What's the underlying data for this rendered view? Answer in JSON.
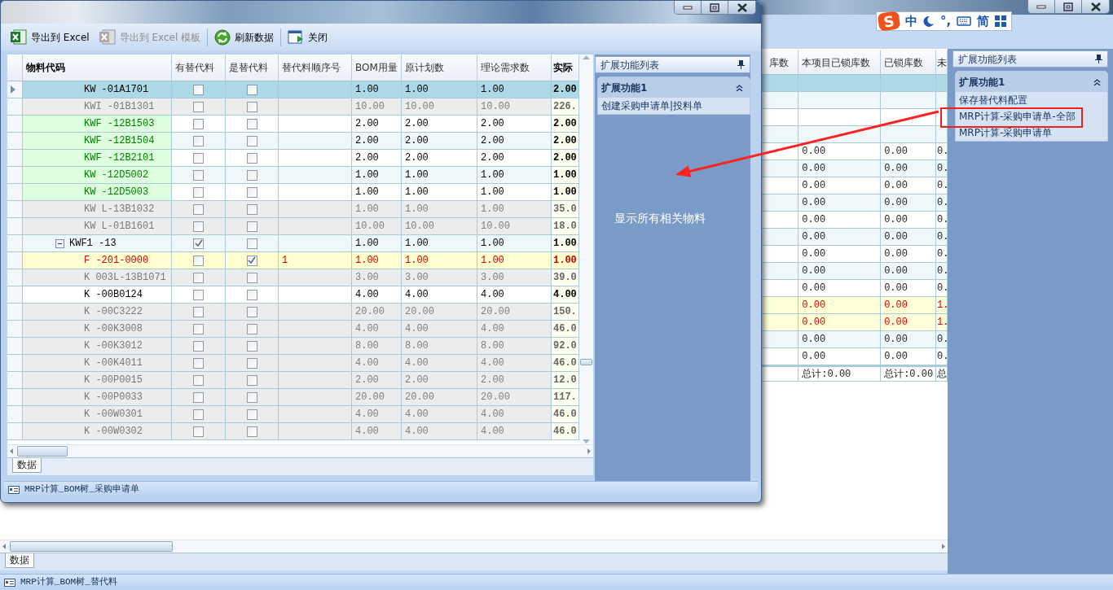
{
  "background": {
    "ime": {
      "logo": "S",
      "items": [
        "中",
        "°,",
        "简"
      ]
    },
    "grid": {
      "columns": [
        "库数",
        "本项目已锁库数",
        "已锁库数",
        "未"
      ],
      "rows": [
        {
          "selected": true,
          "kind": "normal"
        },
        {
          "selected": false,
          "kind": "normal"
        },
        {
          "selected": false,
          "kind": "normal"
        },
        {
          "selected": false,
          "kind": "normal"
        },
        {
          "selected": false,
          "kind": "normal",
          "cells": [
            "0.00",
            "0.00",
            "0."
          ]
        },
        {
          "selected": false,
          "kind": "normal",
          "cells": [
            "0.00",
            "0.00",
            "0."
          ]
        },
        {
          "selected": false,
          "kind": "normal",
          "cells": [
            "0.00",
            "0.00",
            "0."
          ]
        },
        {
          "selected": false,
          "kind": "normal",
          "cells": [
            "0.00",
            "0.00",
            "0."
          ]
        },
        {
          "selected": false,
          "kind": "normal",
          "cells": [
            "0.00",
            "0.00",
            "0."
          ]
        },
        {
          "selected": false,
          "kind": "normal",
          "cells": [
            "0.00",
            "0.00",
            "0."
          ]
        },
        {
          "selected": false,
          "kind": "normal",
          "cells": [
            "0.00",
            "0.00",
            "0."
          ]
        },
        {
          "selected": false,
          "kind": "normal",
          "cells": [
            "0.00",
            "0.00",
            "0."
          ]
        },
        {
          "selected": false,
          "kind": "normal",
          "cells": [
            "0.00",
            "0.00",
            "0."
          ]
        },
        {
          "selected": false,
          "kind": "warn",
          "cells": [
            "0.00",
            "0.00",
            "1."
          ]
        },
        {
          "selected": false,
          "kind": "warn",
          "cells": [
            "0.00",
            "0.00",
            "1."
          ]
        },
        {
          "selected": false,
          "kind": "normal",
          "cells": [
            "0.00",
            "0.00",
            "0."
          ]
        },
        {
          "selected": false,
          "kind": "normal",
          "cells": [
            "0.00",
            "0.00",
            "0."
          ]
        }
      ],
      "totals": [
        "总计:0.00",
        "总计:0.00",
        "总"
      ]
    },
    "tabs": [
      {
        "label": "数据",
        "selected": true
      }
    ],
    "panel": {
      "title": "扩展功能列表",
      "groups": [
        {
          "title": "扩展功能1",
          "expanded": true,
          "items": [
            "保存替代料配置",
            "MRP计算-采购申请单-全部",
            "MRP计算-采购申请单"
          ]
        }
      ]
    },
    "status": "MRP计算_BOM树_替代料"
  },
  "dialog": {
    "toolbar": [
      {
        "label": "导出到 Excel",
        "disabled": false
      },
      {
        "label": "导出到 Excel 模板",
        "disabled": true
      },
      {
        "label": "刷新数据",
        "disabled": false
      },
      {
        "label": "关闭",
        "disabled": false
      }
    ],
    "grid": {
      "columns": [
        "物料代码",
        "有替代料",
        "是替代料",
        "替代料顺序号",
        "BOM用量",
        "原计划数",
        "理论需求数",
        "实际"
      ],
      "rows": [
        {
          "kind": "normal",
          "selected": true,
          "code": "KW -01A1701",
          "has_sub": false,
          "is_sub": false,
          "bom": "1.00",
          "plan": "1.00",
          "need": "1.00",
          "actual": "2.00"
        },
        {
          "kind": "grey",
          "selected": false,
          "code": "KWI -01B1301",
          "has_sub": false,
          "is_sub": false,
          "bom": "10.00",
          "plan": "10.00",
          "need": "10.00",
          "actual": "226."
        },
        {
          "kind": "green",
          "selected": false,
          "code": "KWF -12B1503",
          "has_sub": false,
          "is_sub": false,
          "bom": "2.00",
          "plan": "2.00",
          "need": "2.00",
          "actual": "2.00"
        },
        {
          "kind": "green",
          "selected": false,
          "code": "KWF -12B1504",
          "has_sub": false,
          "is_sub": false,
          "bom": "2.00",
          "plan": "2.00",
          "need": "2.00",
          "actual": "2.00"
        },
        {
          "kind": "green",
          "selected": false,
          "code": "KWF -12B2101",
          "has_sub": false,
          "is_sub": false,
          "bom": "2.00",
          "plan": "2.00",
          "need": "2.00",
          "actual": "2.00"
        },
        {
          "kind": "green",
          "selected": false,
          "code": "KW -12D5002",
          "has_sub": false,
          "is_sub": false,
          "bom": "1.00",
          "plan": "1.00",
          "need": "1.00",
          "actual": "1.00"
        },
        {
          "kind": "green",
          "selected": false,
          "code": "KW -12D5003",
          "has_sub": false,
          "is_sub": false,
          "bom": "1.00",
          "plan": "1.00",
          "need": "1.00",
          "actual": "1.00"
        },
        {
          "kind": "grey",
          "selected": false,
          "code": "KW L-13B1032",
          "has_sub": false,
          "is_sub": false,
          "bom": "1.00",
          "plan": "1.00",
          "need": "1.00",
          "actual": "35.0"
        },
        {
          "kind": "grey",
          "selected": false,
          "code": "KW L-01B1601",
          "has_sub": false,
          "is_sub": false,
          "bom": "10.00",
          "plan": "10.00",
          "need": "10.00",
          "actual": "18.0"
        },
        {
          "kind": "normal",
          "selected": false,
          "code": "KWF1 -13",
          "has_sub": true,
          "is_sub": false,
          "bom": "1.00",
          "plan": "1.00",
          "need": "1.00",
          "actual": "1.00",
          "expanded": true,
          "children": [
            {
              "kind": "red",
              "selected": false,
              "code": "F -201-0000",
              "has_sub": false,
              "is_sub": true,
              "seq": "1",
              "bom": "1.00",
              "plan": "1.00",
              "need": "1.00",
              "actual": "1.00"
            },
            {
              "kind": "grey",
              "selected": false,
              "code": "K 003L-13B1071",
              "has_sub": false,
              "is_sub": false,
              "bom": "3.00",
              "plan": "3.00",
              "need": "3.00",
              "actual": "39.0"
            },
            {
              "kind": "normal",
              "selected": false,
              "code": "K -00B0124",
              "has_sub": false,
              "is_sub": false,
              "bom": "4.00",
              "plan": "4.00",
              "need": "4.00",
              "actual": "4.00"
            },
            {
              "kind": "grey",
              "selected": false,
              "code": "K -00C3222",
              "has_sub": false,
              "is_sub": false,
              "bom": "20.00",
              "plan": "20.00",
              "need": "20.00",
              "actual": "150."
            },
            {
              "kind": "grey",
              "selected": false,
              "code": "K -00K3008",
              "has_sub": false,
              "is_sub": false,
              "bom": "4.00",
              "plan": "4.00",
              "need": "4.00",
              "actual": "46.0"
            },
            {
              "kind": "grey",
              "selected": false,
              "code": "K -00K3012",
              "has_sub": false,
              "is_sub": false,
              "bom": "8.00",
              "plan": "8.00",
              "need": "8.00",
              "actual": "92.0"
            },
            {
              "kind": "grey",
              "selected": false,
              "code": "K -00K4011",
              "has_sub": false,
              "is_sub": false,
              "bom": "4.00",
              "plan": "4.00",
              "need": "4.00",
              "actual": "46.0"
            },
            {
              "kind": "grey",
              "selected": false,
              "code": "K -00P0015",
              "has_sub": false,
              "is_sub": false,
              "bom": "2.00",
              "plan": "2.00",
              "need": "2.00",
              "actual": "12.0"
            },
            {
              "kind": "grey",
              "selected": false,
              "code": "K -00P0033",
              "has_sub": false,
              "is_sub": false,
              "bom": "20.00",
              "plan": "20.00",
              "need": "20.00",
              "actual": "117."
            },
            {
              "kind": "grey",
              "selected": false,
              "code": "K -00W0301",
              "has_sub": false,
              "is_sub": false,
              "bom": "4.00",
              "plan": "4.00",
              "need": "4.00",
              "actual": "46.0"
            },
            {
              "kind": "grey",
              "selected": false,
              "code": "K -00W0302",
              "has_sub": false,
              "is_sub": false,
              "bom": "4.00",
              "plan": "4.00",
              "need": "4.00",
              "actual": "46.0"
            }
          ]
        }
      ]
    },
    "tabs": [
      {
        "label": "数据",
        "selected": true
      }
    ],
    "panel": {
      "title": "扩展功能列表",
      "groups": [
        {
          "title": "扩展功能1",
          "expanded": true,
          "items": [
            "创建采购申请单|投料单"
          ]
        }
      ]
    },
    "note": "显示所有相关物料",
    "status": "MRP计算_BOM树_采购申请单"
  }
}
